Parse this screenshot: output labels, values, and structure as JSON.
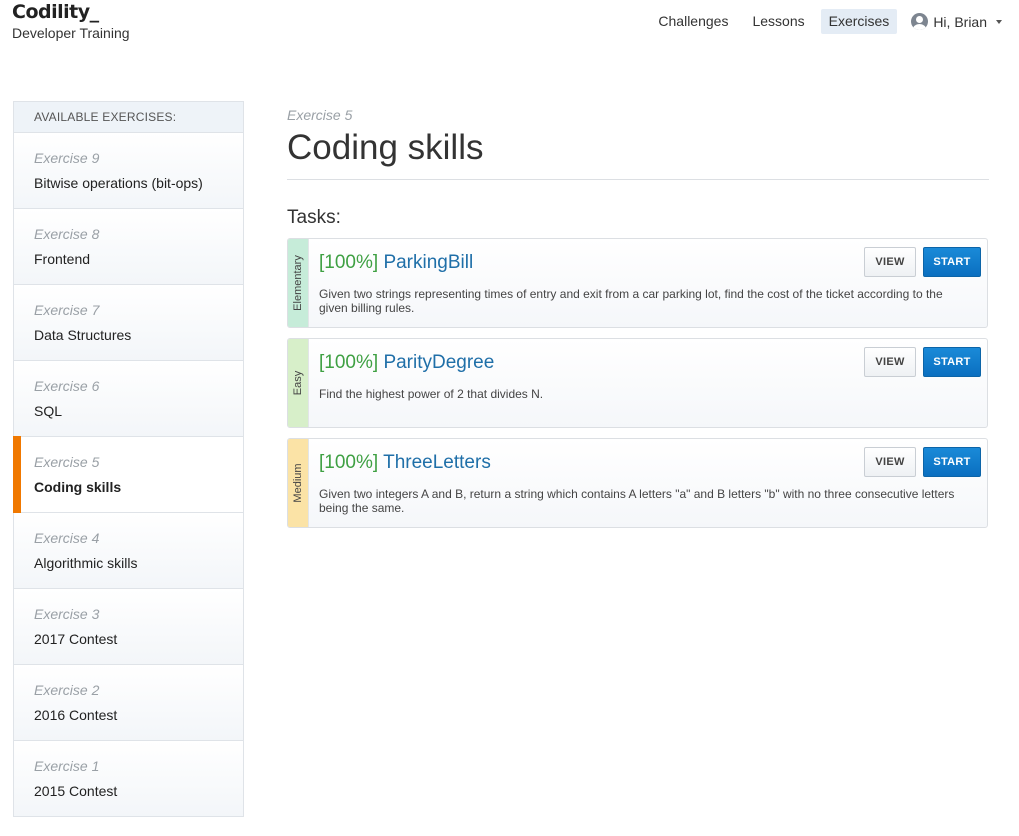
{
  "brand": {
    "logo": "Codility_",
    "subtitle": "Developer Training"
  },
  "nav": {
    "items": [
      {
        "label": "Challenges"
      },
      {
        "label": "Lessons"
      },
      {
        "label": "Exercises",
        "active": true
      }
    ],
    "user_greeting": "Hi, Brian"
  },
  "sidebar": {
    "heading": "AVAILABLE EXERCISES:",
    "items": [
      {
        "number": "Exercise 9",
        "title": "Bitwise operations (bit-ops)"
      },
      {
        "number": "Exercise 8",
        "title": "Frontend"
      },
      {
        "number": "Exercise 7",
        "title": "Data Structures"
      },
      {
        "number": "Exercise 6",
        "title": "SQL"
      },
      {
        "number": "Exercise 5",
        "title": "Coding skills",
        "active": true
      },
      {
        "number": "Exercise 4",
        "title": "Algorithmic skills"
      },
      {
        "number": "Exercise 3",
        "title": "2017 Contest"
      },
      {
        "number": "Exercise 2",
        "title": "2016 Contest"
      },
      {
        "number": "Exercise 1",
        "title": "2015 Contest"
      }
    ]
  },
  "main": {
    "exercise_number": "Exercise 5",
    "title": "Coding skills",
    "tasks_label": "Tasks:",
    "view_label": "VIEW",
    "start_label": "START",
    "tasks": [
      {
        "difficulty": "Elementary",
        "difficulty_color": "#c6ecd9",
        "score": "[100%]",
        "name": "ParkingBill",
        "description": "Given two strings representing times of entry and exit from a car parking lot, find the cost of the ticket according to the given billing rules."
      },
      {
        "difficulty": "Easy",
        "difficulty_color": "#d7efc9",
        "score": "[100%]",
        "name": "ParityDegree",
        "description": "Find the highest power of 2 that divides N."
      },
      {
        "difficulty": "Medium",
        "difficulty_color": "#fbe3a6",
        "score": "[100%]",
        "name": "ThreeLetters",
        "description": "Given two integers A and B, return a string which contains A letters \"a\" and B letters \"b\" with no three consecutive letters being the same."
      }
    ]
  },
  "colors": {
    "accent": "#f07800",
    "start_button": "#0a7ccc",
    "task_link": "#1f6fa8",
    "score_green": "#3fa043",
    "nav_active_bg": "#e4ecf5"
  },
  "icons": {
    "user": "user-avatar-icon",
    "caret": "chevron-down-icon"
  }
}
